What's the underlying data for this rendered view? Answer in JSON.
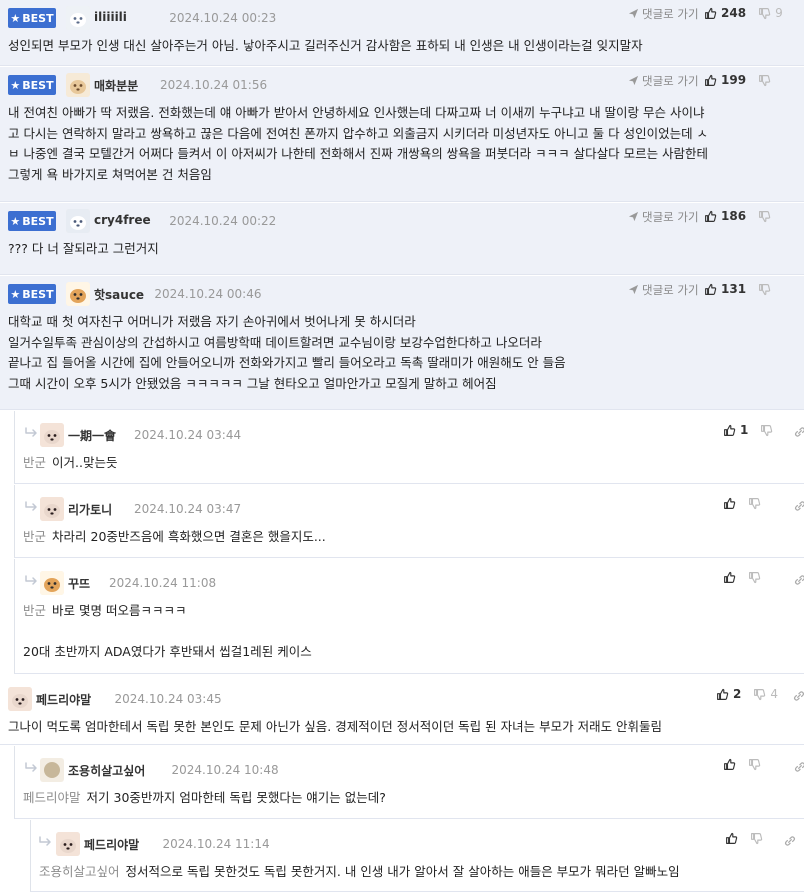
{
  "labels": {
    "best": "BEST",
    "reply_goto": "댓글로 가기"
  },
  "comments": [
    {
      "best": true,
      "nick": "iliiiili",
      "date": "2024.10.24 00:23",
      "avatar": "dog-white",
      "up": "248",
      "down": "9",
      "lines": [
        "성인되면 부모가 인생 대신 살아주는거 아님. 낳아주시고 길러주신거 감사함은 표하되 내 인생은 내 인생이라는걸 잊지말자"
      ]
    },
    {
      "best": true,
      "nick": "매화분분",
      "date": "2024.10.24 01:56",
      "avatar": "dog-puppy",
      "up": "199",
      "down": "",
      "lines": [
        "내 전여친 아빠가 딱 저랬음. 전화했는데 얘 아빠가 받아서 안녕하세요 인사했는데 다짜고짜 너 이새끼 누구냐고 내 딸이랑 무슨 사이냐",
        "고 다시는 연락하지 말라고 쌍욕하고 끊은 다음에 전여친 폰까지 압수하고 외출금지 시키더라 미성년자도 아니고 둘 다 성인이었는데 ㅅ",
        "ㅂ 나중엔 결국 모텔간거 어쩌다 들켜서 이 아저씨가 나한테 전화해서 진짜 개쌍욕의 쌍욕을 퍼붓더라 ㅋㅋㅋ 살다살다 모르는 사람한테",
        "그렇게 욕 바가지로 쳐먹어본 건 처음임"
      ]
    },
    {
      "best": true,
      "nick": "cry4free",
      "date": "2024.10.24 00:22",
      "avatar": "dog-white2",
      "up": "186",
      "down": "",
      "lines": [
        "??? 다 너 잘되라고 그런거지"
      ]
    },
    {
      "best": true,
      "nick": "핫sauce",
      "date": "2024.10.24 00:46",
      "avatar": "chihuahua",
      "up": "131",
      "down": "",
      "lines": [
        "대학교 때 첫 여자친구 어머니가 저랬음 자기 손아귀에서 벗어나게 못 하시더라",
        "일거수일투족 관심이상의 간섭하시고 여름방학때 데이트할려면 교수님이랑 보강수업한다하고 나오더라",
        "끝나고 집 들어올 시간에 집에 안들어오니까 전화와가지고 빨리 들어오라고 독촉 딸래미가 애원해도 안 들음",
        "그때 시간이 오후 5시가 안됐었음 ㅋㅋㅋㅋㅋ 그날 현타오고 얼마안가고 모질게 말하고 헤어짐"
      ]
    },
    {
      "reply": true,
      "nick": "一期一會",
      "date": "2024.10.24 03:44",
      "avatar": "poodle",
      "up": "1",
      "down": "",
      "mention": "반군",
      "lines": [
        "이거..맞는듯"
      ]
    },
    {
      "reply": true,
      "nick": "리가토니",
      "date": "2024.10.24 03:47",
      "avatar": "poodle",
      "up": "",
      "down": "",
      "mention": "반군",
      "lines": [
        "차라리 20중반즈음에 흑화했으면 결혼은 했을지도..."
      ]
    },
    {
      "reply": true,
      "nick": "꾸뜨",
      "date": "2024.10.24 11:08",
      "avatar": "chihuahua",
      "up": "",
      "down": "",
      "mention": "반군",
      "lines": [
        "바로 몇명 떠오름ㅋㅋㅋㅋ",
        "",
        "20대 초반까지 ADA였다가 후반돼서 씹걸1레된 케이스"
      ]
    },
    {
      "nick": "페드리야말",
      "date": "2024.10.24 03:45",
      "avatar": "poodle",
      "up": "2",
      "down": "4",
      "lines": [
        "그나이 먹도록 엄마한테서 독립 못한 본인도 문제 아닌가 싶음. 경제적이던 정서적이던 독립 된 자녀는 부모가 저래도 안휘둘림"
      ]
    },
    {
      "reply": true,
      "nick": "조용히살고싶어",
      "date": "2024.10.24 10:48",
      "avatar": "dot",
      "up": "",
      "down": "",
      "mention": "페드리야말",
      "lines": [
        "저기 30중반까지 엄마한테 독립 못했다는 얘기는 없는데?"
      ]
    },
    {
      "reply": true,
      "nick": "페드리야말",
      "date": "2024.10.24 11:14",
      "avatar": "poodle",
      "up": "",
      "down": "",
      "mention": "조용히살고싶어",
      "lines": [
        "정서적으로 독립 못한것도 독립 못한거지. 내 인생 내가 알아서 잘 살아하는 애들은 부모가 뭐라던 알빠노임"
      ]
    }
  ]
}
